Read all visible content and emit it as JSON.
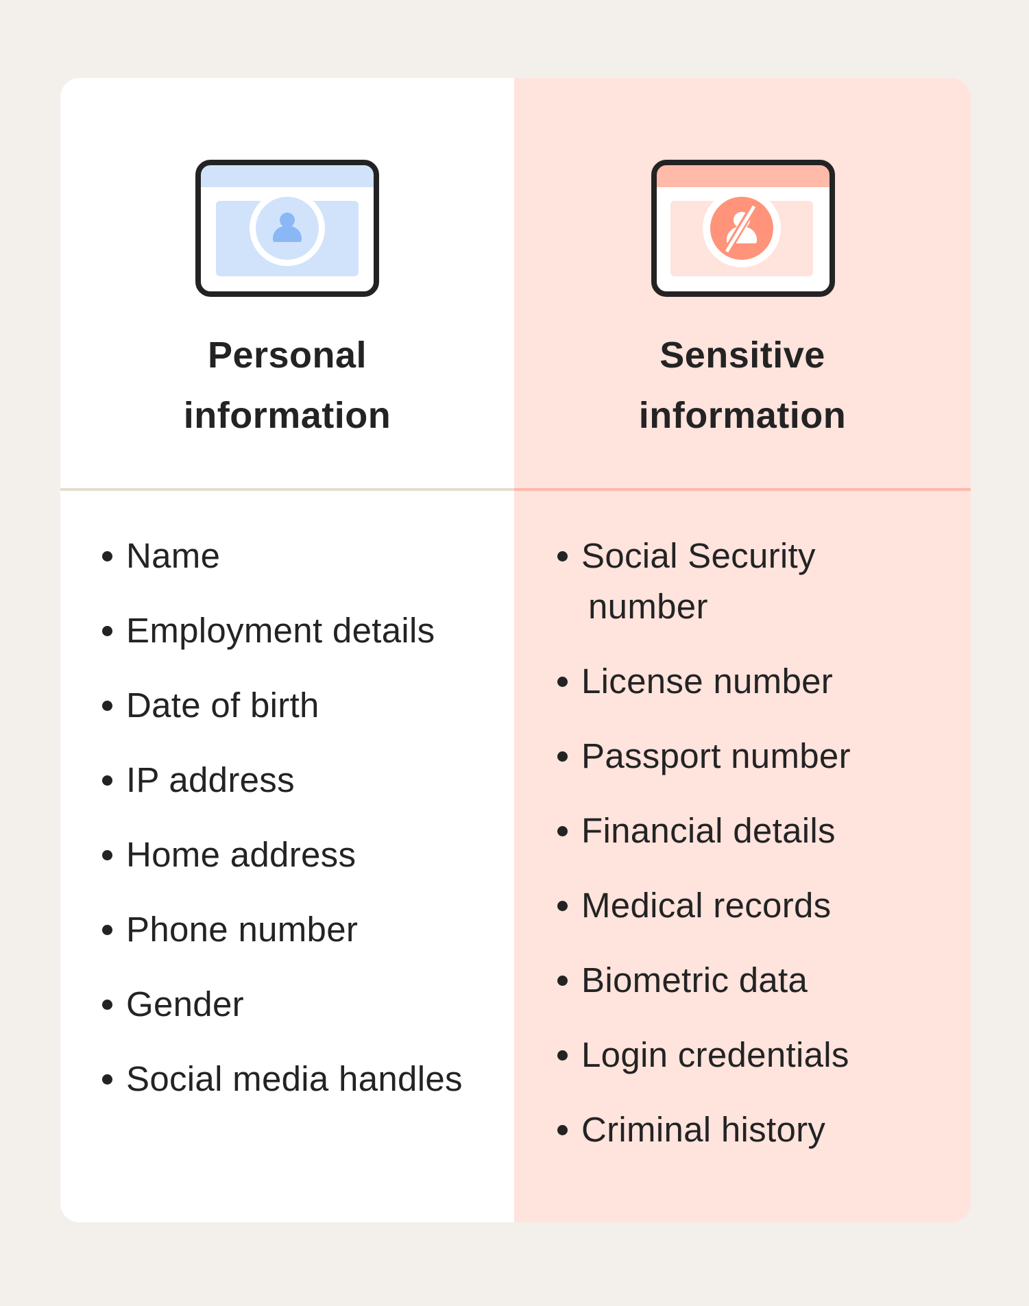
{
  "colors": {
    "background": "#f3f0eb",
    "personal_panel": "#ffffff",
    "sensitive_panel": "#ffe3dd",
    "personal_accent": "#8ab8f7",
    "personal_light": "#d1e3fb",
    "sensitive_accent": "#ff947a",
    "sensitive_light": "#ffbaa9",
    "text": "#232323"
  },
  "columns": {
    "personal": {
      "icon": "user-id-card-icon",
      "heading_line1": "Personal",
      "heading_line2": "information",
      "items": [
        {
          "lines": [
            "Name"
          ]
        },
        {
          "lines": [
            "Employment details"
          ]
        },
        {
          "lines": [
            "Date of birth"
          ]
        },
        {
          "lines": [
            "IP address"
          ]
        },
        {
          "lines": [
            "Home address"
          ]
        },
        {
          "lines": [
            "Phone number"
          ]
        },
        {
          "lines": [
            "Gender"
          ]
        },
        {
          "lines": [
            "Social media handles"
          ]
        }
      ]
    },
    "sensitive": {
      "icon": "user-hidden-id-card-icon",
      "heading_line1": "Sensitive",
      "heading_line2": "information",
      "items": [
        {
          "lines": [
            "Social Security",
            "number"
          ]
        },
        {
          "lines": [
            "License number"
          ]
        },
        {
          "lines": [
            "Passport number"
          ]
        },
        {
          "lines": [
            "Financial details"
          ]
        },
        {
          "lines": [
            "Medical records"
          ]
        },
        {
          "lines": [
            "Biometric data"
          ]
        },
        {
          "lines": [
            "Login credentials"
          ]
        },
        {
          "lines": [
            "Criminal history"
          ]
        }
      ]
    }
  }
}
